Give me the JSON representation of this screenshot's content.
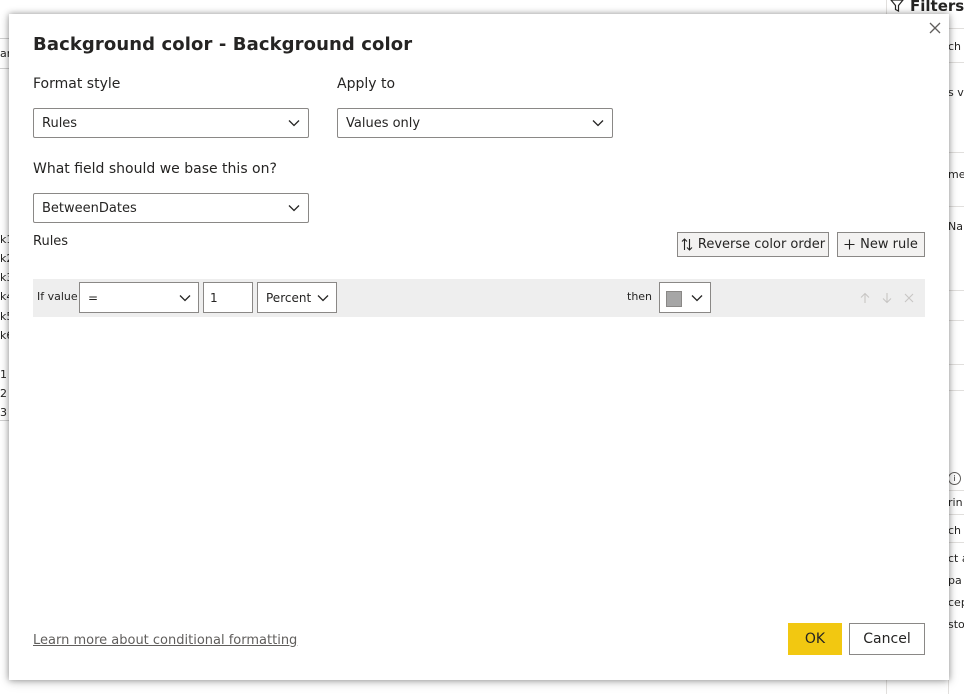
{
  "background": {
    "left_fragments": [
      "ar",
      "k1",
      "k2",
      "k3",
      "k4",
      "k5",
      "k6",
      "1",
      "2",
      "3"
    ],
    "filters_title": "Filters",
    "right_fragments": [
      "ch",
      "s v",
      "me",
      "Na",
      "rin",
      "ch",
      "ct a",
      "pa",
      "cep",
      "sto"
    ]
  },
  "dialog": {
    "title": "Background color - Background color",
    "format_style": {
      "label": "Format style",
      "value": "Rules"
    },
    "apply_to": {
      "label": "Apply to",
      "value": "Values only"
    },
    "base_field": {
      "label": "What field should we base this on?",
      "value": "BetweenDates"
    },
    "rules_label": "Rules",
    "reverse_button": "Reverse color order",
    "new_rule_button": "New rule",
    "rule": {
      "if_value_label": "If value",
      "operator": "=",
      "value": "1",
      "unit": "Percent",
      "then_label": "then",
      "color": "#a6a6a6"
    },
    "learn_more": "Learn more about conditional formatting",
    "ok_button": "OK",
    "cancel_button": "Cancel"
  },
  "colors": {
    "accent": "#f2c811",
    "border": "#8a8886",
    "row_bg": "#eeeeee"
  }
}
